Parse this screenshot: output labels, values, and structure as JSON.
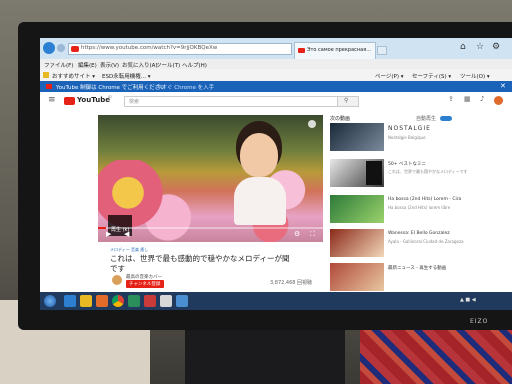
{
  "browser": {
    "url": "https://www.youtube.com/watch?v=9rjjOKBQeXw",
    "tab_title": "Это самое прекрасная...",
    "menu": [
      "ファイル(F)",
      "編集(E)",
      "表示(V)",
      "お気に入り(A)",
      "ツール(T)",
      "ヘルプ(H)"
    ],
    "favorites": [
      "おすすめサイト ▾",
      "ESD永転用機権... ▾"
    ],
    "tools": [
      "ページ(P) ▾",
      "セーフティ(S) ▾",
      "ツール(O) ▾"
    ]
  },
  "notification": {
    "text": "YouTube 制御は Chrome でご利用ください",
    "action": "今すぐ Chrome を入手"
  },
  "youtube": {
    "logo": "YouTube",
    "region": "JP",
    "search_placeholder": "検索",
    "autoplay_label": "自動再生",
    "next_label": "次の動画",
    "video_title_line1": "これは、世界で最も感動的で穏やかなメロディーが聞",
    "video_title_line2": "です",
    "views": "3,872,468 回視聴",
    "subscribe": "チャンネル登録",
    "channel": "最高の音楽カバー",
    "tooltip": "再生 (k)",
    "small_label": "メロディー 音楽 癒し",
    "related": [
      {
        "title": "NOSTALGIE",
        "sub": "Nostalgie Belgique"
      },
      {
        "title": "50+ ベストなミニ",
        "sub": "これは、世界で最も穏やかなメロディーです"
      },
      {
        "title": "Ha bossa (2nd Hits) Lorem - Cira",
        "sub": "Ha bossa (2nd Hits) lorem libre"
      },
      {
        "title": "Wanessa: El Bello Gonzalez",
        "sub": "Ayala - Gallinoral Ciudad de Zaragoza"
      },
      {
        "title": "最新ニュース - 再生する動画",
        "sub": ""
      }
    ]
  },
  "colors": {
    "tab_bar": "#cfe3f3",
    "notify": "#1a63b8",
    "youtube_red": "#e62117",
    "taskbar": "#1f3a5c"
  }
}
